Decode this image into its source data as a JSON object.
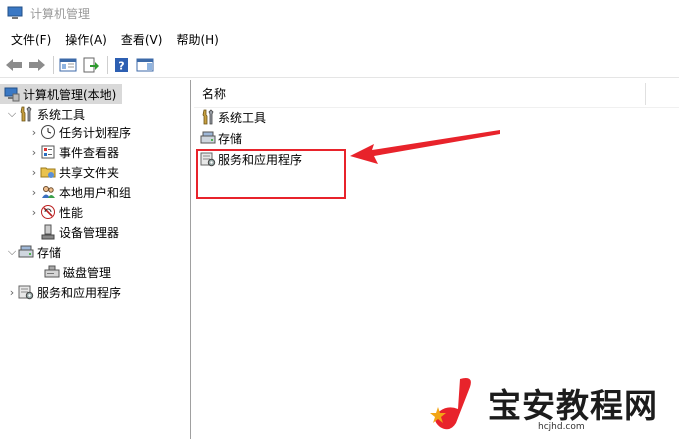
{
  "window": {
    "title": "计算机管理"
  },
  "menu": [
    "文件(F)",
    "操作(A)",
    "查看(V)",
    "帮助(H)"
  ],
  "toolbar": {
    "icons": [
      "back-arrow-icon",
      "forward-arrow-icon",
      "console-tree-icon",
      "export-list-icon",
      "help-icon",
      "show-hide-pane-icon"
    ]
  },
  "tree": {
    "root": "计算机管理(本地)",
    "system_tools": "系统工具",
    "task_scheduler": "任务计划程序",
    "event_viewer": "事件查看器",
    "shared_folders": "共享文件夹",
    "local_users": "本地用户和组",
    "performance": "性能",
    "device_manager": "设备管理器",
    "storage": "存储",
    "disk_management": "磁盘管理",
    "services_apps": "服务和应用程序"
  },
  "list": {
    "column_name": "名称",
    "items": [
      "系统工具",
      "存储",
      "服务和应用程序"
    ]
  },
  "colors": {
    "highlight": "#e8232b",
    "selection": "#d9d9d9",
    "watermark_red": "#e8232b"
  },
  "watermark": {
    "brand": "宝安教程网",
    "domain": "hcjhd.com"
  }
}
